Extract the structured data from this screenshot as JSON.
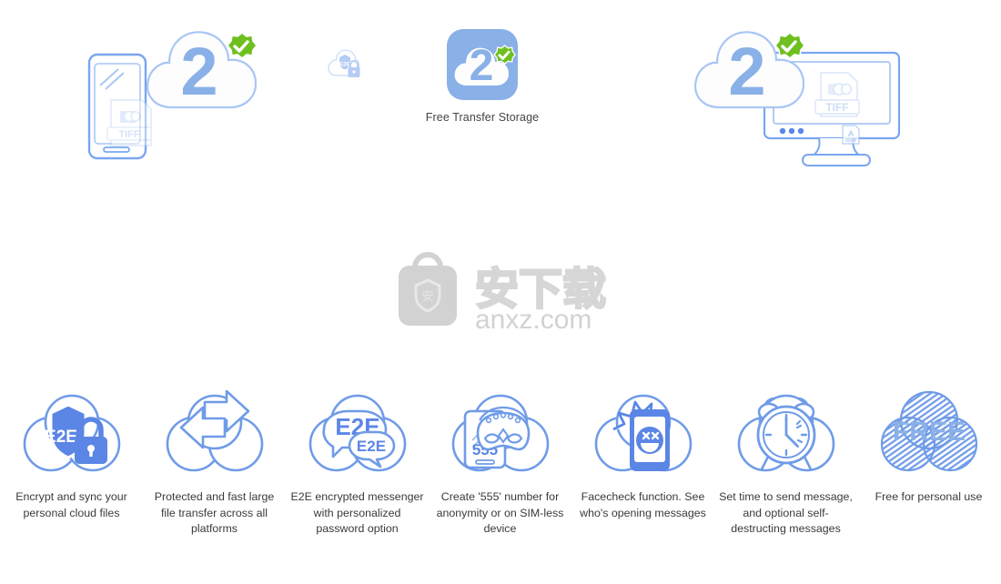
{
  "page": {
    "background_color": "#ffffff",
    "brand_blue": "#8ab0e8",
    "brand_blue_strong": "#5b86e5",
    "icon_blue": "#6f9be8",
    "shield_green": "#6fbf1f",
    "text_color": "#3a3a3a"
  },
  "hero": {
    "phone": {
      "icon": "smartphone-icon",
      "file_label": "TIFF"
    },
    "cloud_left": {
      "icon": "cloud-icon",
      "number": "2",
      "badge": "verified-shield-icon"
    },
    "mini_lock": {
      "icon": "cloud-lock-icon",
      "label": "E2E"
    },
    "app_icon": {
      "icon": "app-tile-icon",
      "number": "2",
      "badge": "verified-shield-icon"
    },
    "app_icon_label": "Free Transfer Storage",
    "cloud_right": {
      "icon": "cloud-icon",
      "number": "2",
      "badge": "verified-shield-icon"
    },
    "monitor": {
      "icon": "desktop-monitor-icon",
      "file_label": "TIFF",
      "corner_badge": "font-file-icon"
    }
  },
  "watermark": {
    "icon": "anxz-bag-icon",
    "glyph": "安",
    "chinese_text": "安下载",
    "domain_text": "anxz.com",
    "color": "#d2d2d2"
  },
  "features": [
    {
      "icon": "cloud-e2e-lock-icon",
      "icon_text": "E2E",
      "caption": "Encrypt and sync your personal cloud files"
    },
    {
      "icon": "cloud-transfer-arrows-icon",
      "icon_text": "",
      "caption": "Protected and fast large file transfer across all platforms"
    },
    {
      "icon": "chat-bubbles-e2e-icon",
      "icon_text": "E2E",
      "icon_text_2": "E2E",
      "caption": "E2E encrypted messenger with personalized password option"
    },
    {
      "icon": "phone-mask-555-icon",
      "icon_text": "555",
      "caption": "Create '555' number for anonymity or on SIM-less device"
    },
    {
      "icon": "phone-facecheck-icon",
      "icon_text": "",
      "caption": "Facecheck function. See who's opening messages"
    },
    {
      "icon": "alarm-clock-cloud-icon",
      "icon_text": "",
      "caption": "Set time to send message, and optional self-destructing messages"
    },
    {
      "icon": "cloud-free-striped-icon",
      "icon_text": "FREE",
      "caption": "Free for personal use"
    }
  ]
}
